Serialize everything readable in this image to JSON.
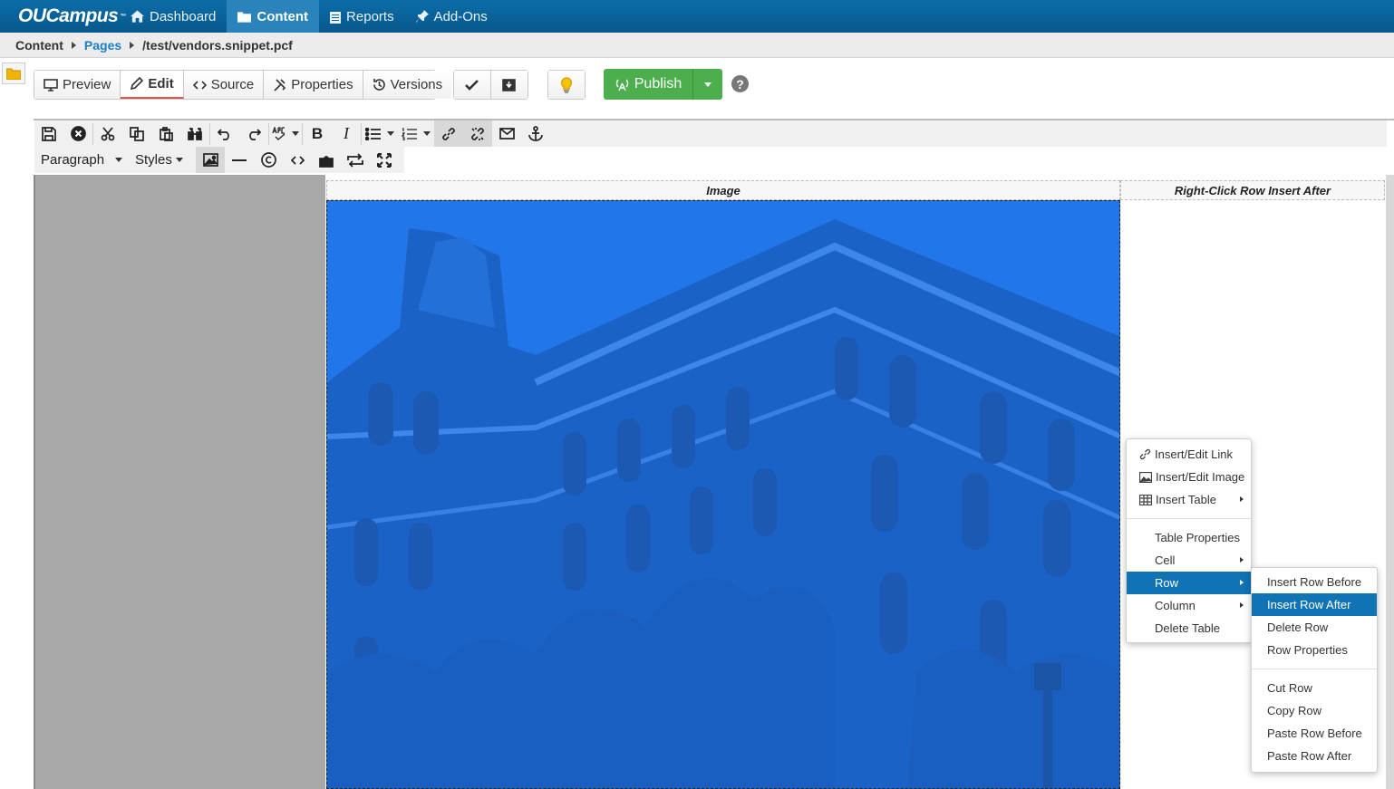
{
  "app": {
    "logo": "OUCampus",
    "logo_tm": "™"
  },
  "nav": {
    "items": [
      {
        "label": "Dashboard"
      },
      {
        "label": "Content"
      },
      {
        "label": "Reports"
      },
      {
        "label": "Add-Ons"
      }
    ]
  },
  "breadcrumb": {
    "root": "Content",
    "pages": "Pages",
    "file": "/test/vendors.snippet.pcf"
  },
  "actions": {
    "preview": "Preview",
    "edit": "Edit",
    "source": "Source",
    "properties": "Properties",
    "versions": "Versions",
    "publish": "Publish",
    "help": "?"
  },
  "editor": {
    "format_select": "Paragraph",
    "styles_select": "Styles"
  },
  "table": {
    "header_image": "Image",
    "header_right": "Right-Click Row Insert After"
  },
  "context_menu": {
    "insert_link": "Insert/Edit Link",
    "insert_image": "Insert/Edit Image",
    "insert_table": "Insert Table",
    "table_properties": "Table Properties",
    "cell": "Cell",
    "row": "Row",
    "column": "Column",
    "delete_table": "Delete Table"
  },
  "row_submenu": {
    "insert_before": "Insert Row Before",
    "insert_after": "Insert Row After",
    "delete_row": "Delete Row",
    "row_properties": "Row Properties",
    "cut_row": "Cut Row",
    "copy_row": "Copy Row",
    "paste_before": "Paste Row Before",
    "paste_after": "Paste Row After"
  },
  "colors": {
    "nav_bg": "#07588c",
    "publish": "#4cae4c",
    "highlight": "#0f73b4",
    "image_tint": "#1f72e6"
  }
}
